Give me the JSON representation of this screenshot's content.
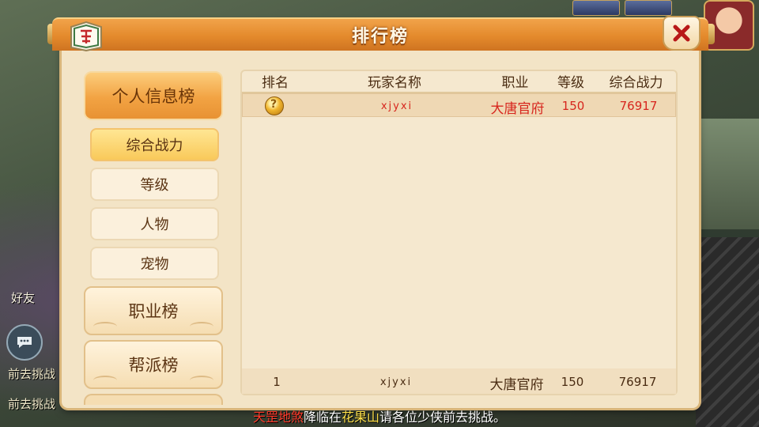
{
  "window": {
    "title": "排行榜"
  },
  "scene": {
    "friends_label": "好友",
    "side_text_1": "前去挑战",
    "side_text_2": "前去挑战"
  },
  "nav": {
    "main": [
      {
        "label": "个人信息榜",
        "active": true
      },
      {
        "label": "职业榜",
        "active": false
      },
      {
        "label": "帮派榜",
        "active": false
      }
    ],
    "sub": [
      {
        "label": "综合战力",
        "active": true
      },
      {
        "label": "等级",
        "active": false
      },
      {
        "label": "人物",
        "active": false
      },
      {
        "label": "宠物",
        "active": false
      }
    ]
  },
  "table": {
    "headers": {
      "rank": "排名",
      "name": "玩家名称",
      "job": "职业",
      "level": "等级",
      "power": "综合战力"
    },
    "rows": [
      {
        "rank_icon": "gold-medal-icon",
        "name": "xjyxi",
        "job": "大唐官府",
        "level": "150",
        "power": "76917"
      }
    ],
    "self_row": {
      "rank": "1",
      "name": "xjyxi",
      "job": "大唐官府",
      "level": "150",
      "power": "76917"
    }
  },
  "broadcast": {
    "boss": "天罡地煞",
    "mid": "降临在",
    "place": "花果山",
    "tail": "请各位少侠前去挑战。"
  },
  "colors": {
    "title_bar": "#e48a2c",
    "panel_bg": "#f3e4c6",
    "highlight_text": "#d7261e",
    "active_tab": "#f2a343"
  }
}
